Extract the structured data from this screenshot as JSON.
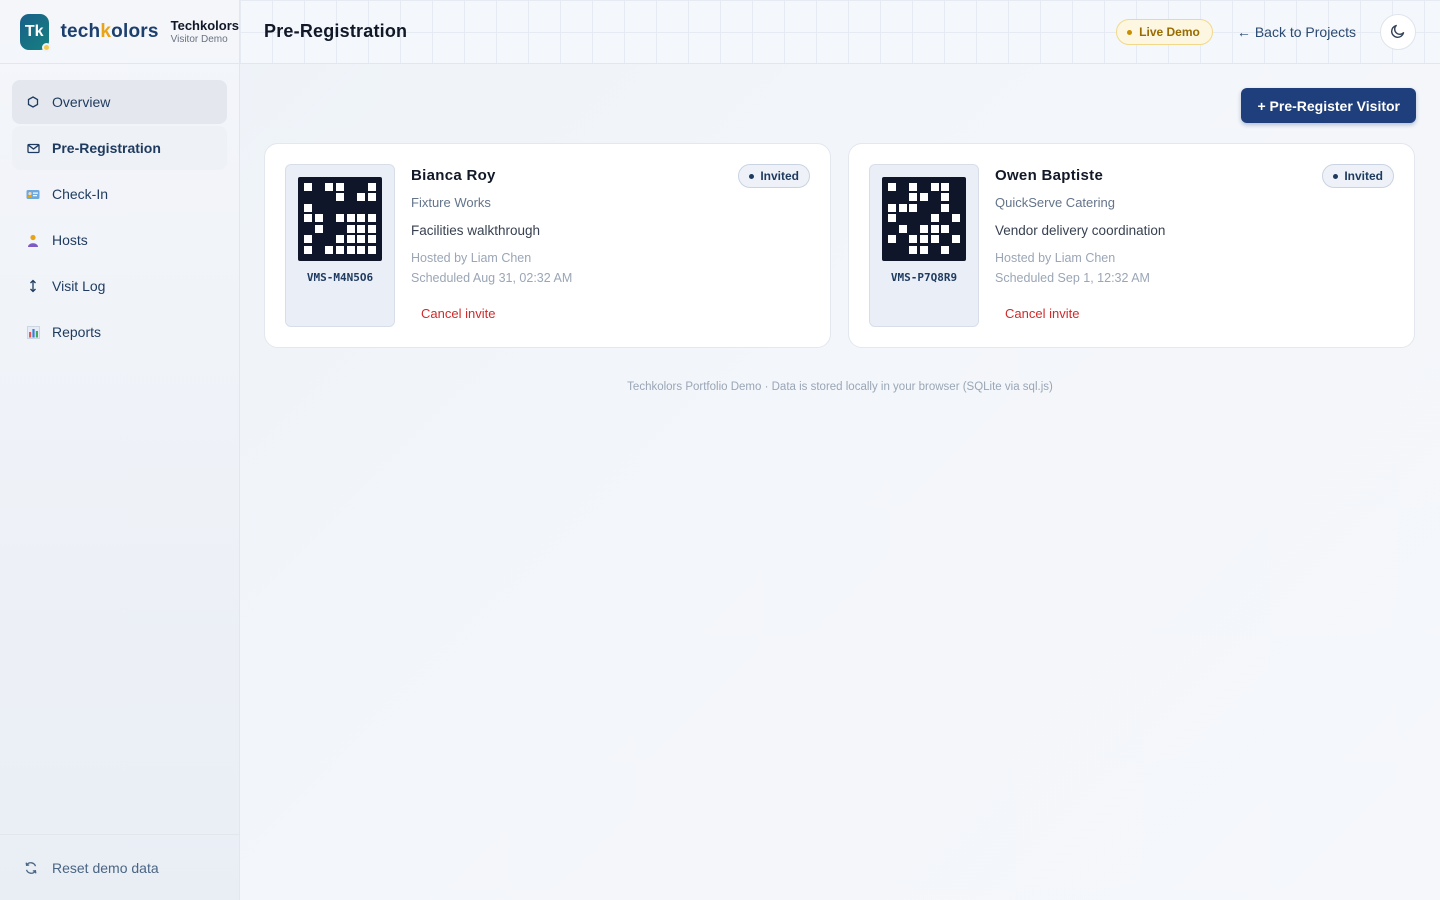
{
  "brand": {
    "tile": "Tk",
    "wordmark_a": "tech",
    "wordmark_k": "k",
    "wordmark_b": "olors",
    "name": "Techkolors",
    "sub": "Visitor Demo"
  },
  "nav": [
    {
      "label": "Overview",
      "icon": "hexagon-icon"
    },
    {
      "label": "Pre-Registration",
      "icon": "envelope-icon"
    },
    {
      "label": "Check-In",
      "icon": "id-card-icon"
    },
    {
      "label": "Hosts",
      "icon": "person-icon"
    },
    {
      "label": "Visit Log",
      "icon": "up-down-arrow-icon"
    },
    {
      "label": "Reports",
      "icon": "bar-chart-icon"
    }
  ],
  "footer_action": "Reset demo data",
  "header": {
    "title": "Pre-Registration",
    "badge": "Live Demo",
    "back": "Back to Projects"
  },
  "actions": {
    "preregister": "+ Pre-Register Visitor"
  },
  "visitors": [
    {
      "name": "Bianca Roy",
      "status": "Invited",
      "company": "Fixture Works",
      "purpose": "Facilities walkthrough",
      "host": "Hosted by Liam Chen",
      "scheduled": "Scheduled Aug 31, 02:32 AM",
      "code": "VMS-M4N5O6",
      "cancel": "Cancel invite"
    },
    {
      "name": "Owen Baptiste",
      "status": "Invited",
      "company": "QuickServe Catering",
      "purpose": "Vendor delivery coordination",
      "host": "Hosted by Liam Chen",
      "scheduled": "Scheduled Sep 1, 12:32 AM",
      "code": "VMS-P7Q8R9",
      "cancel": "Cancel invite"
    }
  ],
  "footer_note": "Techkolors Portfolio Demo · Data is stored locally in your browser (SQLite via sql.js)",
  "colors": {
    "primary": "#1e3f7c",
    "accent": "#e8a317",
    "danger": "#d12a2a",
    "live": "#9a6b00"
  }
}
